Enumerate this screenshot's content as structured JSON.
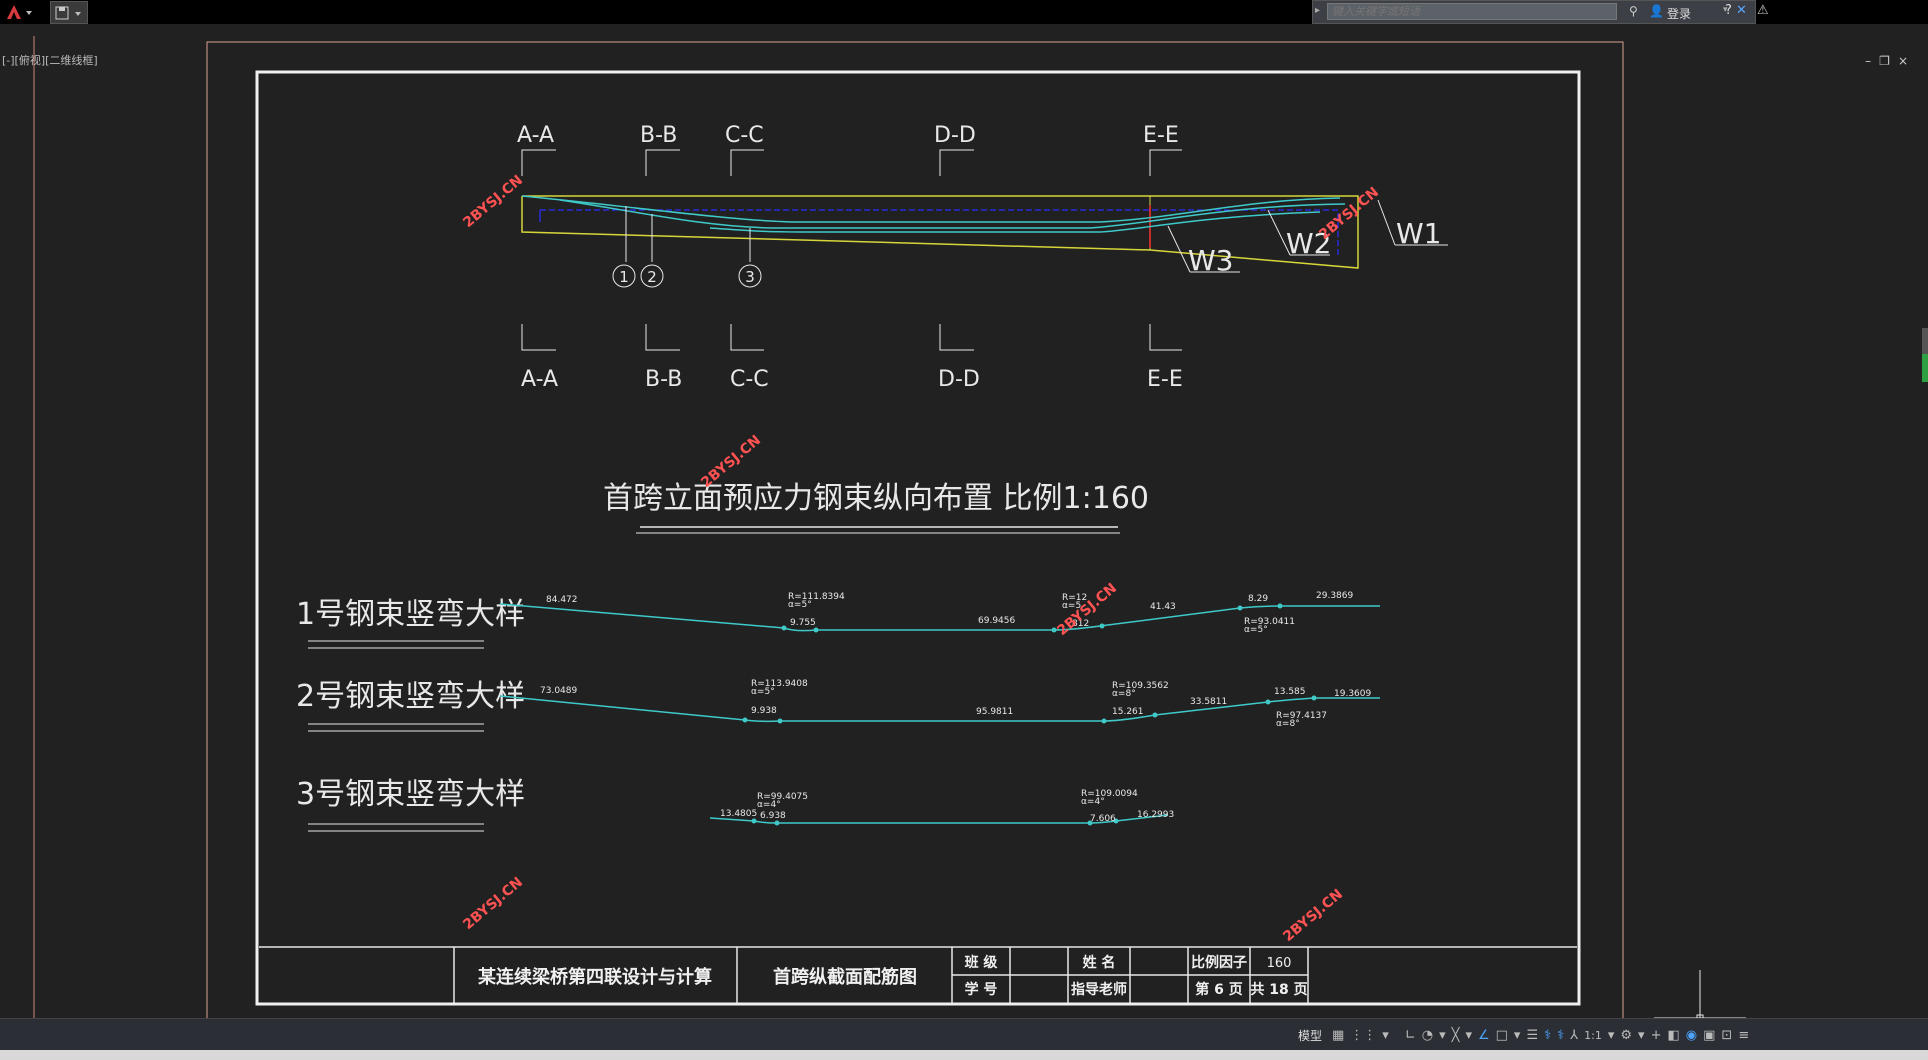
{
  "app": {
    "search_placeholder": "键入关键字或短语",
    "login_label": "登录",
    "viewport_label": "[-][俯视][二维线框]"
  },
  "drawing": {
    "section_labels_top": [
      "A-A",
      "B-B",
      "C-C",
      "D-D",
      "E-E"
    ],
    "section_labels_bottom": [
      "A-A",
      "B-B",
      "C-C",
      "D-D",
      "E-E"
    ],
    "tendon_markers": [
      "1",
      "2",
      "3"
    ],
    "web_labels": [
      "W1",
      "W2",
      "W3"
    ],
    "main_title": "首跨立面预应力钢束纵向布置 比例1:160",
    "watermark": "2BYSJ.CN",
    "details": [
      {
        "label": "1号钢束竖弯大样",
        "annotations": [
          "84.472",
          "R=111.8394",
          "α=5°",
          "9.755",
          "69.9456",
          "R=12",
          "α=5",
          "812",
          "41.43",
          "8.29",
          "29.3869",
          "R=93.0411",
          "α=5°"
        ]
      },
      {
        "label": "2号钢束竖弯大样",
        "annotations": [
          "73.0489",
          "R=113.9408",
          "α=5°",
          "9.938",
          "95.9811",
          "R=109.3562",
          "α=8°",
          "15.261",
          "33.5811",
          "13.585",
          "19.3609",
          "R=97.4137",
          "α=8°"
        ]
      },
      {
        "label": "3号钢束竖弯大样",
        "annotations": [
          "13.4805",
          "R=99.4075",
          "α=4°",
          "6.938",
          "R=109.0094",
          "α=4°",
          "7.606",
          "16.2993"
        ]
      }
    ]
  },
  "title_block": {
    "project": "某连续梁桥第四联设计与计算",
    "drawing_name": "首跨纵截面配筋图",
    "class_label": "班 级",
    "student_id_label": "学 号",
    "name_label": "姓 名",
    "advisor_label": "指导老师",
    "scale_label": "比例因子",
    "scale_value": "160",
    "page_label": "第 6 页",
    "total_label": "共 18 页"
  },
  "statusbar": {
    "model_label": "模型",
    "scale_label": "1:1"
  },
  "colors": {
    "cyan": "#3fc9c9",
    "yellow": "#d6d63a",
    "blue": "#2a2ad8",
    "red": "#ff3030",
    "white": "#e8e8e8"
  }
}
